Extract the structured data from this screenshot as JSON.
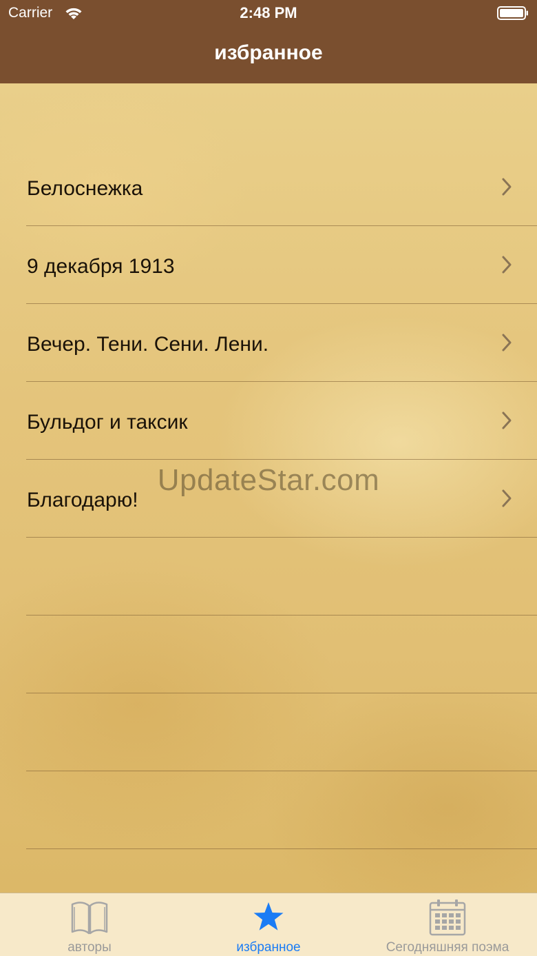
{
  "status_bar": {
    "carrier": "Carrier",
    "time": "2:48 PM"
  },
  "nav": {
    "title": "избранное"
  },
  "favorites": {
    "items": [
      {
        "label": "Белоснежка"
      },
      {
        "label": "9 декабря 1913"
      },
      {
        "label": "Вечер. Тени. Сени. Лени."
      },
      {
        "label": "Бульдог и таксик"
      },
      {
        "label": "Благодарю!"
      }
    ]
  },
  "watermark": "UpdateStar.com",
  "tabbar": {
    "tabs": [
      {
        "label": "авторы",
        "icon": "book-icon",
        "active": false
      },
      {
        "label": "избранное",
        "icon": "star-icon",
        "active": true
      },
      {
        "label": "Сегодняшняя поэма",
        "icon": "calendar-icon",
        "active": false
      }
    ]
  },
  "colors": {
    "nav_background": "#7a4f2f",
    "accent": "#1a7cf5",
    "tab_inactive": "#9a9a9a",
    "tabbar_background": "#f7e9c9"
  }
}
